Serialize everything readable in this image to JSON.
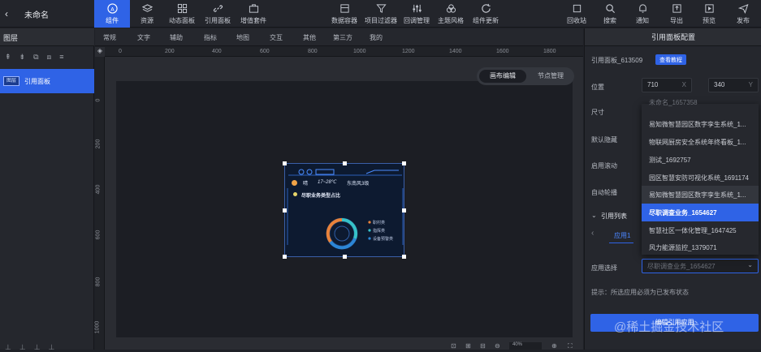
{
  "topbar": {
    "title": "未命名",
    "left_items": [
      "组件",
      "资源",
      "动态面板",
      "引用面板",
      "增值套件"
    ],
    "center_items": [
      "数据容器",
      "项目过滤器",
      "回调管理",
      "主题风格",
      "组件更新"
    ],
    "right_items": [
      "回收站",
      "搜索",
      "通知",
      "导出",
      "预览",
      "发布"
    ]
  },
  "left_panel": {
    "title": "图层",
    "layer_label": "引用面板",
    "layer_thumb": "图层"
  },
  "section_tabs": [
    "常规",
    "文字",
    "辅助",
    "指标",
    "地图",
    "交互",
    "其他",
    "第三方",
    "我的"
  ],
  "ruler": {
    "h": [
      "0",
      "200",
      "400",
      "600",
      "800",
      "1000",
      "1200",
      "1400",
      "1600",
      "1800"
    ],
    "v": [
      "0",
      "200",
      "400",
      "600",
      "800",
      "1000"
    ]
  },
  "canvas": {
    "mode_tabs": [
      "画布编辑",
      "节点管理"
    ],
    "preview": {
      "weather": "晴",
      "temp": "17~28℃",
      "wind": "东南风3级",
      "title": "尽职业务类型占比",
      "legend": [
        "职村类",
        "指挥类",
        "设备预警类"
      ]
    }
  },
  "right_panel": {
    "title": "引用面板配置",
    "panel_name": "引用面板_613509",
    "tutorial_btn": "查看教程",
    "pos_label": "位置",
    "x_value": "710",
    "x_unit": "X",
    "y_value": "340",
    "y_unit": "Y",
    "size_label": "尺寸",
    "hide_label": "默认隐藏",
    "scroll_label": "启用滚动",
    "carousel_label": "自动轮播",
    "list_label": "引用列表",
    "app_tab": "应用1",
    "app_select_label": "应用选择",
    "app_select_value": "尽职调查业务_1654627",
    "hint": "提示：所选应用必须为已发布状态",
    "dropdown": [
      "未命名_1657358",
      "易知微智慧园区数字孪生系统_1...",
      "物联网厨房安全系统年终看板_1...",
      "测试_1692757",
      "园区智慧安防可视化系统_1691174",
      "易知微智慧园区数字孪生系统_1...",
      "尽职调查业务_1654627",
      "智慧社区一体化管理_1647425",
      "风力能源监控_1379071"
    ],
    "bottom_btn": "编辑引用应用"
  },
  "bottom": {
    "zoom": "40%"
  },
  "watermark": "@稀土掘金技术社区",
  "colors": {
    "accent": "#2f63e6",
    "bg": "#1f2127",
    "panel": "#25272d"
  }
}
